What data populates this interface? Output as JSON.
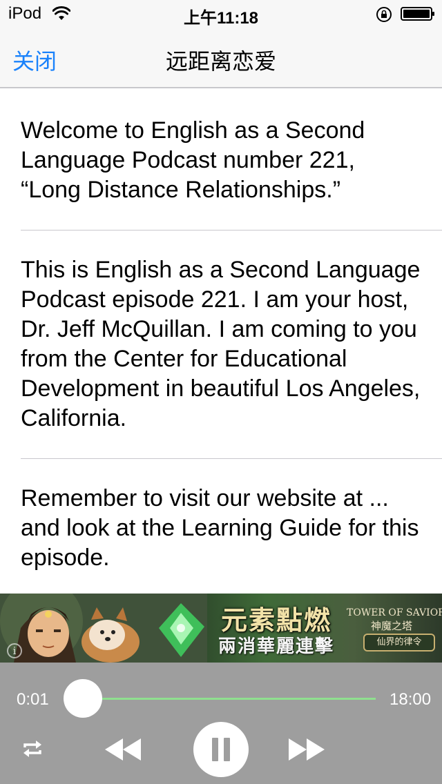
{
  "status_bar": {
    "carrier": "iPod",
    "time": "上午11:18",
    "icons": [
      "wifi-icon",
      "rotation-lock-icon",
      "battery-icon"
    ]
  },
  "nav": {
    "close_label": "关闭",
    "title": "远距离恋爱"
  },
  "transcript": {
    "paragraphs": [
      "Welcome to English as a Second Language Podcast number 221, “Long Distance Relationships.”",
      "This is English as a Second Language Podcast episode 221. I am your host, Dr. Jeff McQuillan. I am coming to you from the Center for Educational Development in beautiful Los Angeles, California.",
      "Remember to visit our website at ... and look at the Learning Guide for this episode."
    ]
  },
  "ad": {
    "headline": "元素點燃",
    "subline": "兩消華麗連擊",
    "brand": "TOWER OF SAVIORS",
    "brand_cn": "神魔之塔",
    "brand_button": "仙界的律令"
  },
  "player": {
    "elapsed": "0:01",
    "total": "18:00",
    "progress": 0.001,
    "accent_color": "#8fe08f",
    "icons": [
      "repeat-icon",
      "rewind-icon",
      "pause-icon",
      "fast-forward-icon"
    ]
  }
}
